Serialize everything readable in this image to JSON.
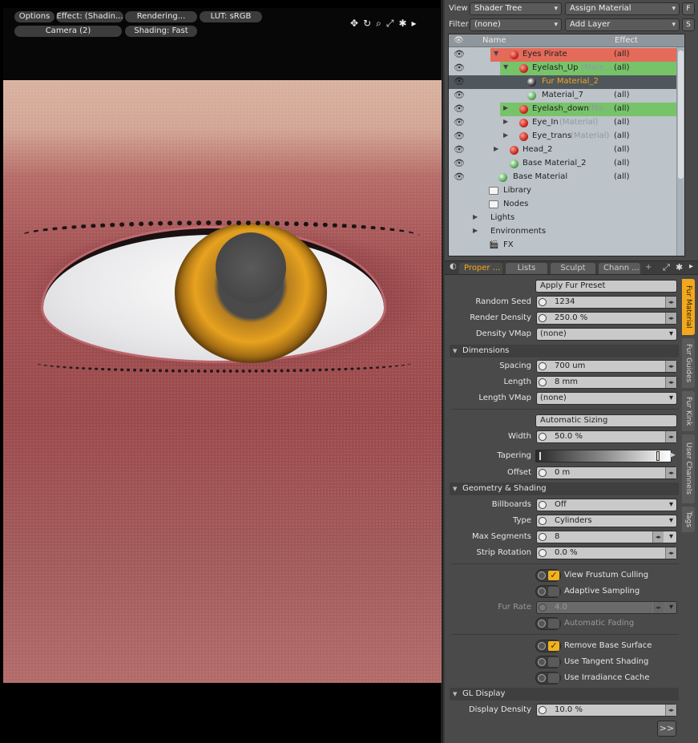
{
  "viewport": {
    "buttons": [
      "Options",
      "Effect: (Shadin...",
      "Rendering...",
      "LUT: sRGB",
      "Camera (2)",
      "Shading: Fast"
    ],
    "icons": [
      "move-icon",
      "rotate-icon",
      "zoom-icon",
      "fit-icon",
      "gear-icon",
      "expand-arrow-icon"
    ]
  },
  "header": {
    "view_label": "View",
    "view_value": "Shader Tree",
    "assign_material": "Assign Material",
    "f_label": "F",
    "filter_label": "Filter",
    "filter_value": "(none)",
    "add_layer": "Add Layer",
    "s_label": "S"
  },
  "tree": {
    "col_name": "Name",
    "col_effect": "Effect",
    "rows": [
      {
        "name": "Eyes Pirate",
        "effect": "(all)"
      },
      {
        "name": "Eyelash_Up",
        "tag": "(Mate...",
        "effect": "(all)"
      },
      {
        "name": "Fur Material_2",
        "effect": ""
      },
      {
        "name": "Material_7",
        "effect": "(all)"
      },
      {
        "name": "Eyelash_down",
        "tag": "(Ma...",
        "effect": "(all)"
      },
      {
        "name": "Eye_In",
        "tag": "(Material)",
        "effect": "(all)"
      },
      {
        "name": "Eye_trans",
        "tag": "(Material)",
        "effect": "(all)"
      },
      {
        "name": "Head_2",
        "effect": "(all)"
      },
      {
        "name": "Base Material_2",
        "effect": "(all)"
      },
      {
        "name": "Base Material",
        "effect": "(all)"
      },
      {
        "name": "Library"
      },
      {
        "name": "Nodes"
      },
      {
        "name": "Lights"
      },
      {
        "name": "Environments"
      },
      {
        "name": "FX"
      }
    ]
  },
  "tabs": [
    "Proper ...",
    "Lists",
    "Sculpt",
    "Chann ...",
    "+"
  ],
  "vertical_tabs": [
    "Fur Material",
    "Fur Guides",
    "Fur Kink",
    "User Channels",
    "Tags"
  ],
  "props": {
    "apply_preset": "Apply Fur Preset",
    "random_seed_label": "Random Seed",
    "random_seed": "1234",
    "render_density_label": "Render Density",
    "render_density": "250.0 %",
    "density_vmap_label": "Density VMap",
    "density_vmap": "(none)",
    "dimensions": "Dimensions",
    "spacing_label": "Spacing",
    "spacing": "700 um",
    "length_label": "Length",
    "length": "8 mm",
    "length_vmap_label": "Length VMap",
    "length_vmap": "(none)",
    "automatic_sizing": "Automatic Sizing",
    "width_label": "Width",
    "width": "50.0 %",
    "tapering_label": "Tapering",
    "offset_label": "Offset",
    "offset": "0 m",
    "geometry_shading": "Geometry & Shading",
    "billboards_label": "Billboards",
    "billboards": "Off",
    "type_label": "Type",
    "type": "Cylinders",
    "max_segments_label": "Max Segments",
    "max_segments": "8",
    "strip_rotation_label": "Strip Rotation",
    "strip_rotation": "0.0 %",
    "view_frustum": "View Frustum Culling",
    "adaptive_sampling": "Adaptive Sampling",
    "fur_rate_label": "Fur Rate",
    "fur_rate": "4.0",
    "automatic_fading": "Automatic Fading",
    "remove_base": "Remove Base Surface",
    "tangent_shading": "Use Tangent Shading",
    "irradiance_cache": "Use Irradiance Cache",
    "gl_display": "GL Display",
    "display_density_label": "Display Density",
    "display_density": "10.0 %",
    "more": ">>"
  },
  "colors": {
    "accent": "#f2a81d",
    "row_red": "#e46a5a",
    "row_green": "#77c36a",
    "row_selected": "#4f565c"
  }
}
